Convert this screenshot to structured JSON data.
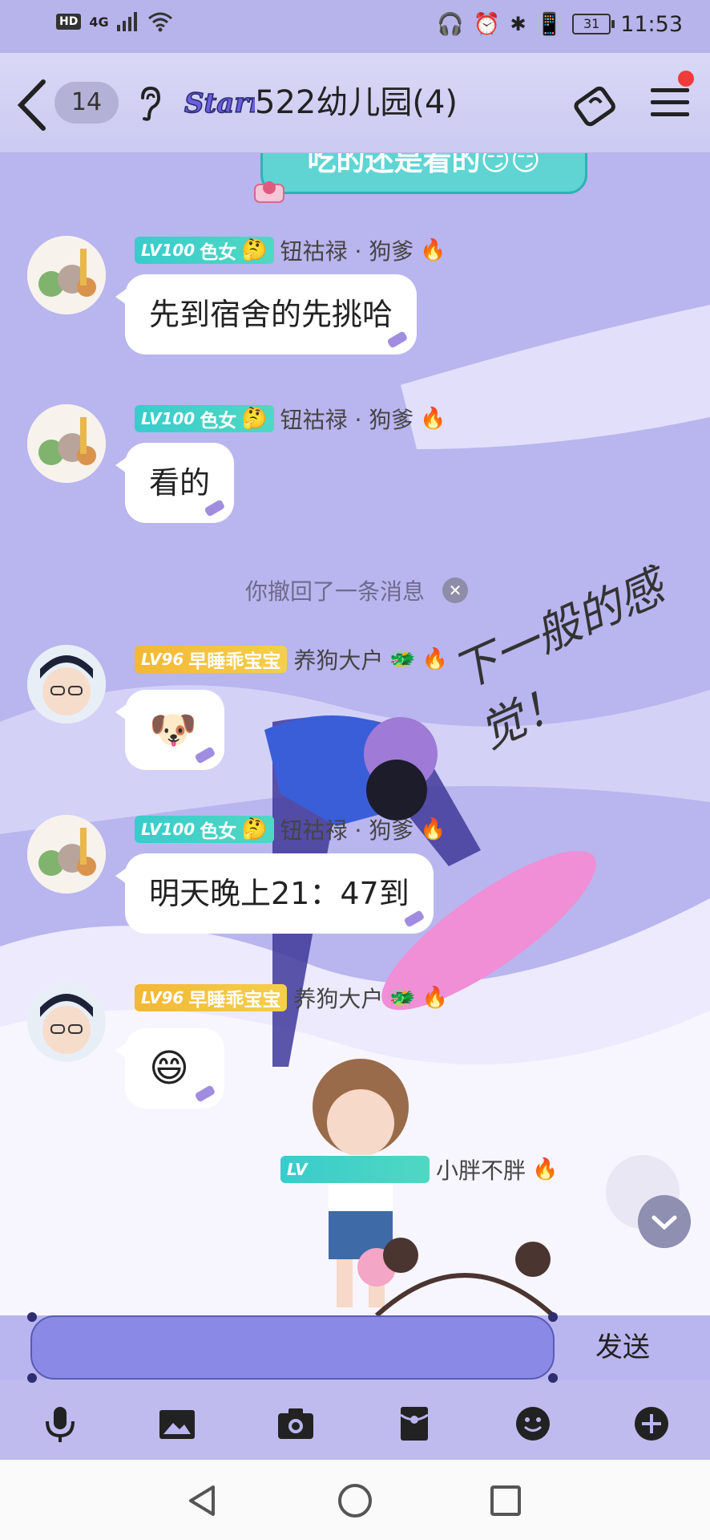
{
  "status_bar": {
    "signal_text": "4G",
    "battery": "31",
    "time": "11:53",
    "icons": [
      "hd-icon",
      "signal-icon",
      "wifi-icon",
      "headphones-icon",
      "alarm-icon",
      "bluetooth-icon",
      "vibrate-icon",
      "battery-icon"
    ]
  },
  "header": {
    "unread_count": "14",
    "brand_logo_text": "Starry",
    "title": "522幼儿园(4)"
  },
  "chat": {
    "top_bubble_text": "吃的还是看的",
    "messages": [
      {
        "level": "LV100",
        "title": "色女",
        "sender": "钮祜禄 · 狗爹",
        "text": "先到宿舍的先挑哈"
      },
      {
        "level": "LV100",
        "title": "色女",
        "sender": "钮祜禄 · 狗爹",
        "text": "看的"
      },
      {
        "level": "LV96",
        "title": "早睡乖宝宝",
        "sender": "养狗大户",
        "text": ""
      },
      {
        "level": "LV100",
        "title": "色女",
        "sender": "钮祜禄 · 狗爹",
        "text": "明天晚上21：47到"
      },
      {
        "level": "LV96",
        "title": "早睡乖宝宝",
        "sender": "养狗大户",
        "text": ""
      },
      {
        "level": "LV",
        "title": "",
        "sender": "小胖不胖",
        "text": ""
      }
    ],
    "recall_notice": "你撤回了一条消息",
    "signature_text": "下一般的感觉！"
  },
  "input": {
    "send_label": "发送"
  },
  "toolbar": {
    "items": [
      "microphone-icon",
      "image-icon",
      "camera-icon",
      "red-packet-icon",
      "emoji-icon",
      "plus-icon"
    ]
  },
  "colors": {
    "background": "#b9b5ee",
    "teal_badge": "#39cccc",
    "gold_badge": "#f3b735",
    "input_bar": "#8a8ae6",
    "notification_dot": "#f03b3b"
  }
}
